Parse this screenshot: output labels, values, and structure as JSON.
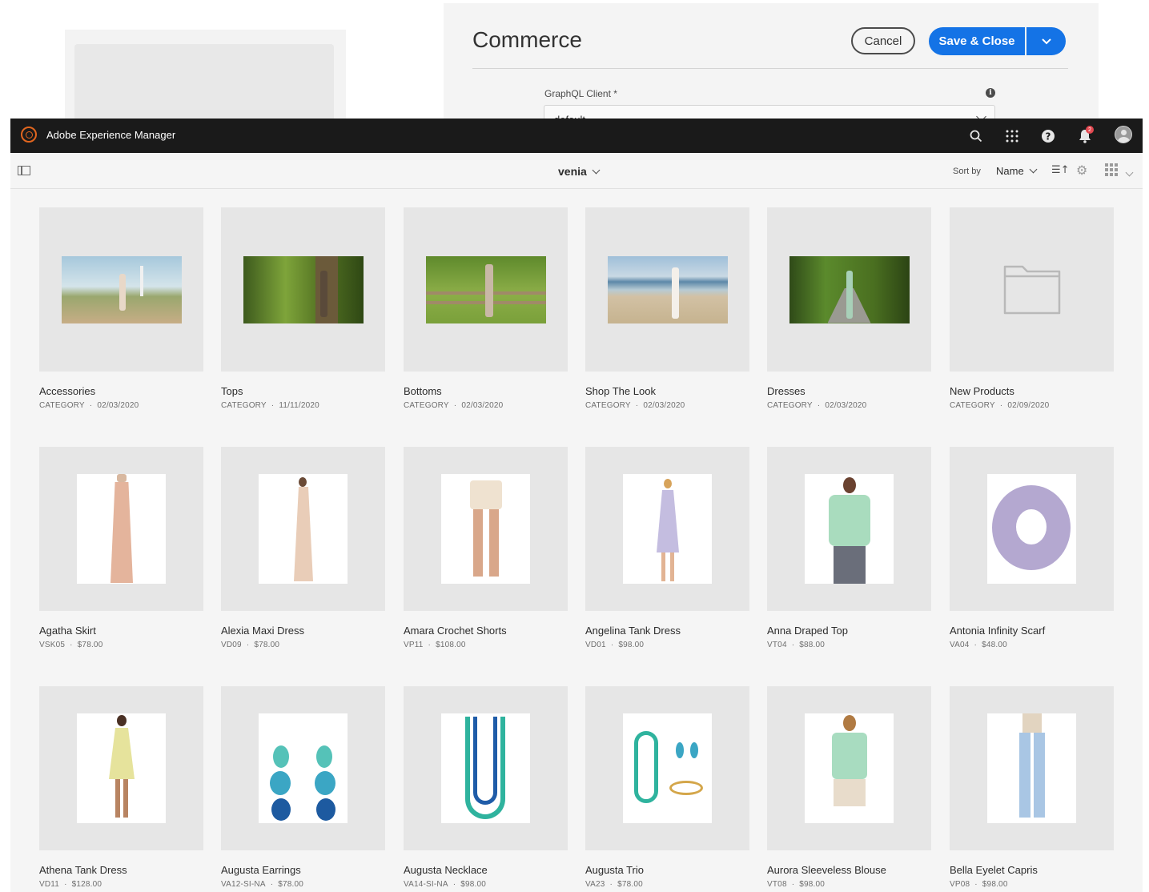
{
  "dialog": {
    "title": "Commerce",
    "cancel_label": "Cancel",
    "save_label": "Save & Close",
    "field_label": "GraphQL Client *",
    "field_value": "default"
  },
  "header": {
    "app_title": "Adobe Experience Manager",
    "notification_count": "2",
    "icons": [
      "search-icon",
      "apps-grid-icon",
      "help-icon",
      "bell-icon",
      "avatar"
    ]
  },
  "actionbar": {
    "breadcrumb": "venia",
    "sort_by_label": "Sort by",
    "sort_value": "Name"
  },
  "colors": {
    "accent": "#1473e6",
    "topbar": "#1a1a1a",
    "logo": "#e2661f",
    "badge": "#e34850",
    "thumb_bg": "#e6e6e6"
  },
  "cards": [
    {
      "title": "Accessories",
      "code": "CATEGORY",
      "detail": "02/03/2020",
      "thumb": "landscape",
      "scene": "lighthouse-path"
    },
    {
      "title": "Tops",
      "code": "CATEGORY",
      "detail": "11/11/2020",
      "thumb": "landscape",
      "scene": "forest"
    },
    {
      "title": "Bottoms",
      "code": "CATEGORY",
      "detail": "02/03/2020",
      "thumb": "landscape",
      "scene": "fence-field"
    },
    {
      "title": "Shop The Look",
      "code": "CATEGORY",
      "detail": "02/03/2020",
      "thumb": "landscape",
      "scene": "beach"
    },
    {
      "title": "Dresses",
      "code": "CATEGORY",
      "detail": "02/03/2020",
      "thumb": "landscape",
      "scene": "boardwalk"
    },
    {
      "title": "New Products",
      "code": "CATEGORY",
      "detail": "02/09/2020",
      "thumb": "folder",
      "scene": "folder-icon"
    },
    {
      "title": "Agatha Skirt",
      "code": "VSK05",
      "detail": "$78.00",
      "thumb": "portrait",
      "scene": "long-skirt"
    },
    {
      "title": "Alexia Maxi Dress",
      "code": "VD09",
      "detail": "$78.00",
      "thumb": "portrait",
      "scene": "maxi-dress"
    },
    {
      "title": "Amara Crochet Shorts",
      "code": "VP11",
      "detail": "$108.00",
      "thumb": "portrait",
      "scene": "shorts"
    },
    {
      "title": "Angelina Tank Dress",
      "code": "VD01",
      "detail": "$98.00",
      "thumb": "portrait",
      "scene": "tank-dress"
    },
    {
      "title": "Anna Draped Top",
      "code": "VT04",
      "detail": "$88.00",
      "thumb": "portrait",
      "scene": "draped-top"
    },
    {
      "title": "Antonia Infinity Scarf",
      "code": "VA04",
      "detail": "$48.00",
      "thumb": "portrait",
      "scene": "scarf"
    },
    {
      "title": "Athena Tank Dress",
      "code": "VD11",
      "detail": "$128.00",
      "thumb": "portrait",
      "scene": "short-dress"
    },
    {
      "title": "Augusta Earrings",
      "code": "VA12-SI-NA",
      "detail": "$78.00",
      "thumb": "portrait",
      "scene": "earrings"
    },
    {
      "title": "Augusta Necklace",
      "code": "VA14-SI-NA",
      "detail": "$98.00",
      "thumb": "portrait",
      "scene": "necklace"
    },
    {
      "title": "Augusta Trio",
      "code": "VA23",
      "detail": "$78.00",
      "thumb": "portrait",
      "scene": "jewelry-trio"
    },
    {
      "title": "Aurora Sleeveless Blouse",
      "code": "VT08",
      "detail": "$98.00",
      "thumb": "portrait",
      "scene": "blouse"
    },
    {
      "title": "Bella Eyelet Capris",
      "code": "VP08",
      "detail": "$98.00",
      "thumb": "portrait",
      "scene": "capris"
    }
  ]
}
